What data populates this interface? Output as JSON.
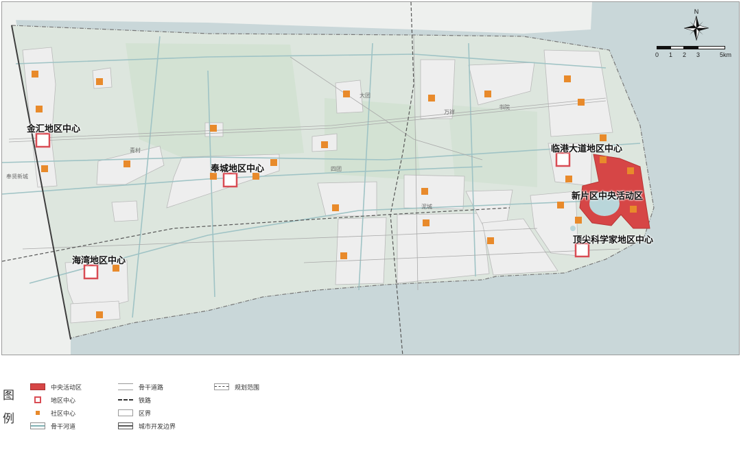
{
  "map": {
    "center_labels": {
      "jinhui": "金汇地区中心",
      "fengcheng": "奉城地区中心",
      "haiwan": "海湾地区中心",
      "lingang": "临港大道地区中心",
      "xinpian": "新片区中央活动区",
      "dingjian": "顶尖科学家地区中心"
    },
    "place_labels": {
      "datuan": "大团",
      "wanxiang": "万祥",
      "shuyuan": "书院",
      "qingcun": "青村",
      "xidu": "四团",
      "nihui": "泥城",
      "fengxian": "奉贤新城"
    },
    "scale": {
      "ticks": [
        "0",
        "1",
        "2",
        "3",
        "5km"
      ]
    },
    "compass": {
      "north_label": "N",
      "icon": "compass-rose-icon"
    },
    "colors": {
      "sea": "#c9d7d9",
      "land_outside": "#eef0ee",
      "land_inside": "#dde6de",
      "green_tint": "#cfe0cf",
      "built_area": "#eeeeee",
      "river": "#9fc3c5",
      "cbd": "#d64646",
      "community": "#e88a2b",
      "district_center_border": "#d94c54",
      "lake": "#b9d6da"
    }
  },
  "legend": {
    "title": "图例",
    "items": [
      {
        "label": "中央活动区",
        "icon": "central-activity-zone-swatch"
      },
      {
        "label": "地区中心",
        "icon": "district-center-swatch"
      },
      {
        "label": "社区中心",
        "icon": "community-center-swatch"
      },
      {
        "label": "骨干河道",
        "icon": "main-river-swatch"
      },
      {
        "label": "骨干道路",
        "icon": "main-road-swatch"
      },
      {
        "label": "铁路",
        "icon": "railway-swatch"
      },
      {
        "label": "区界",
        "icon": "district-boundary-swatch"
      },
      {
        "label": "城市开发边界",
        "icon": "urban-development-boundary-swatch"
      },
      {
        "label": "规划范围",
        "icon": "planning-scope-swatch"
      }
    ]
  }
}
